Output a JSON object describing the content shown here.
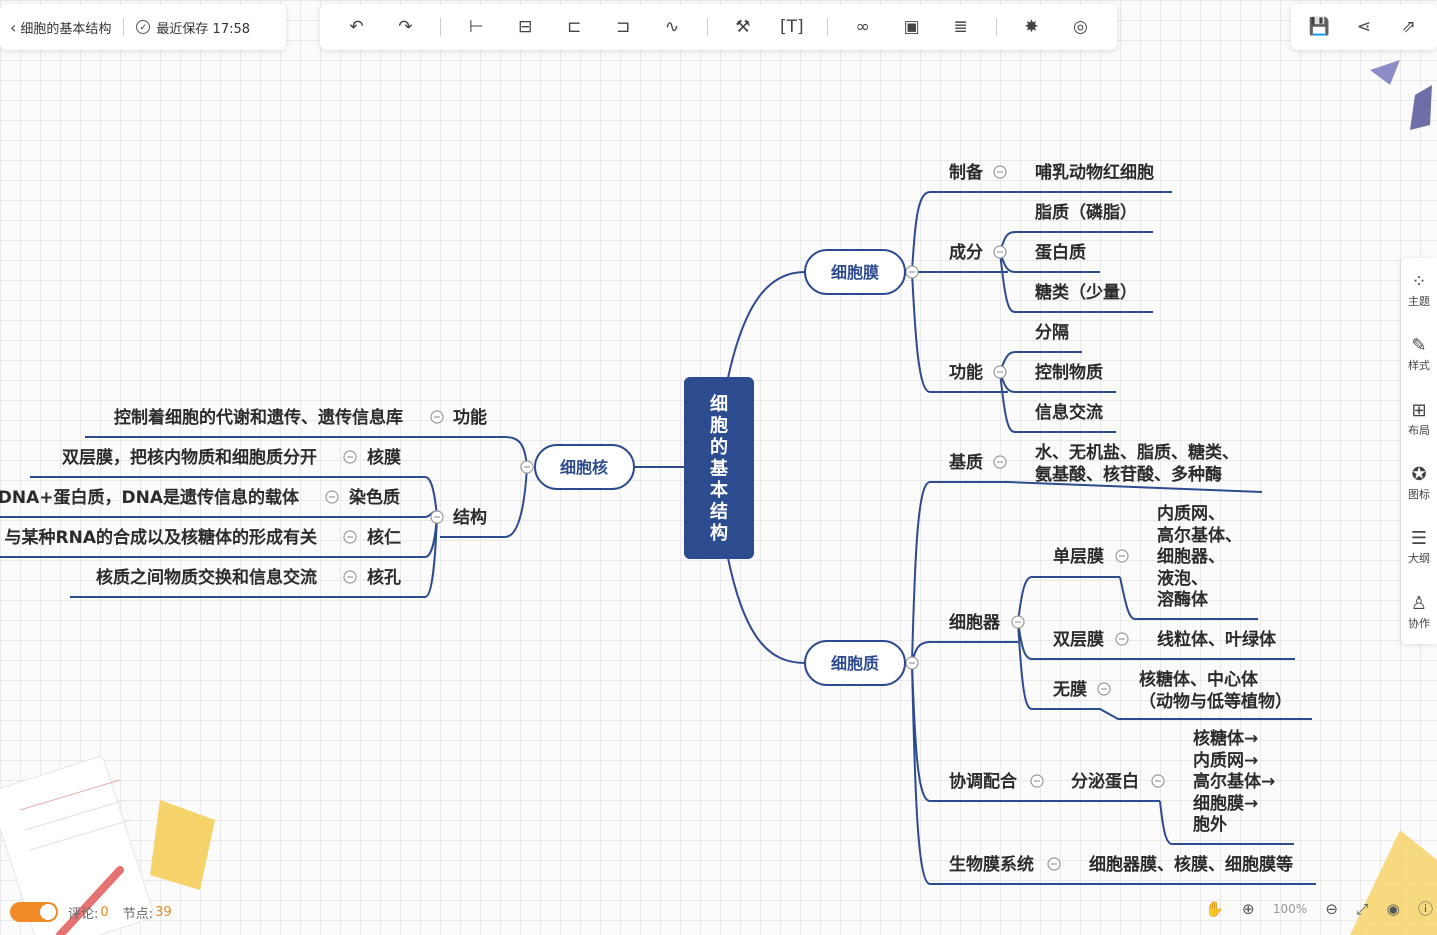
{
  "header": {
    "doc_title": "细胞的基本结构",
    "save_status": "最近保存 17:58"
  },
  "toolbar": {
    "tools": [
      {
        "name": "undo-icon",
        "glyph": "↶"
      },
      {
        "name": "redo-icon",
        "glyph": "↷"
      },
      {
        "name": "add-child-icon",
        "glyph": "⊢"
      },
      {
        "name": "add-sibling-icon",
        "glyph": "⊟"
      },
      {
        "name": "add-parent-icon",
        "glyph": "⊏"
      },
      {
        "name": "summary-icon",
        "glyph": "⊐"
      },
      {
        "name": "relation-icon",
        "glyph": "∿"
      },
      {
        "name": "format-painter-icon",
        "glyph": "⚒"
      },
      {
        "name": "insert-text-icon",
        "glyph": "[T]"
      },
      {
        "name": "link-icon",
        "glyph": "∞"
      },
      {
        "name": "image-icon",
        "glyph": "▣"
      },
      {
        "name": "note-icon",
        "glyph": "≣"
      },
      {
        "name": "magic-icon",
        "glyph": "✸"
      },
      {
        "name": "explore-icon",
        "glyph": "◎"
      }
    ]
  },
  "top_right": {
    "tools": [
      {
        "name": "save-icon",
        "glyph": "💾"
      },
      {
        "name": "share-icon",
        "glyph": "⋖"
      },
      {
        "name": "export-icon",
        "glyph": "⇗"
      }
    ]
  },
  "right_rail": {
    "items": [
      {
        "name": "theme",
        "glyph": "⁘",
        "label": "主题"
      },
      {
        "name": "style",
        "glyph": "✎",
        "label": "样式"
      },
      {
        "name": "layout",
        "glyph": "⊞",
        "label": "布局"
      },
      {
        "name": "icon",
        "glyph": "✪",
        "label": "图标"
      },
      {
        "name": "outline",
        "glyph": "☰",
        "label": "大纲"
      },
      {
        "name": "collab",
        "glyph": "♙",
        "label": "协作"
      }
    ]
  },
  "mindmap": {
    "root": "细胞的基本结构",
    "membrane": "细胞膜",
    "membrane_prep": "制备",
    "membrane_prep_val": "哺乳动物红细胞",
    "membrane_comp": "成分",
    "membrane_comp_1": "脂质（磷脂）",
    "membrane_comp_2": "蛋白质",
    "membrane_comp_3": "糖类（少量）",
    "membrane_func": "功能",
    "membrane_func_1": "分隔",
    "membrane_func_2": "控制物质",
    "membrane_func_3": "信息交流",
    "cytoplasm": "细胞质",
    "matrix": "基质",
    "matrix_val_1": "水、无机盐、脂质、糖类、",
    "matrix_val_2": "氨基酸、核苷酸、多种酶",
    "organelle": "细胞器",
    "single": "单层膜",
    "single_val": [
      "内质网、",
      "高尔基体、",
      "细胞器、",
      "液泡、",
      "溶酶体"
    ],
    "double": "双层膜",
    "double_val": "线粒体、叶绿体",
    "none": "无膜",
    "none_val_1": "核糖体、中心体",
    "none_val_2": "（动物与低等植物）",
    "coord": "协调配合",
    "secret": "分泌蛋白",
    "secret_val": [
      "核糖体→",
      "内质网→",
      "高尔基体→",
      "细胞膜→",
      "胞外"
    ],
    "biomem": "生物膜系统",
    "biomem_val": "细胞器膜、核膜、细胞膜等",
    "nucleus": "细胞核",
    "nuc_func": "功能",
    "nuc_func_val": "控制着细胞的代谢和遗传、遗传信息库",
    "nuc_struct": "结构",
    "nuc_mem": "核膜",
    "nuc_mem_val": "双层膜，把核内物质和细胞质分开",
    "chromatin": "染色质",
    "chromatin_val": "DNA+蛋白质，DNA是遗传信息的载体",
    "nucleolus": "核仁",
    "nucleolus_val": "与某种RNA的合成以及核糖体的形成有关",
    "pore": "核孔",
    "pore_val": "核质之间物质交换和信息交流"
  },
  "footer": {
    "comments_label": "评论:",
    "comments_count": "0",
    "nodes_label": "节点:",
    "nodes_count": "39",
    "zoom": "100%"
  }
}
